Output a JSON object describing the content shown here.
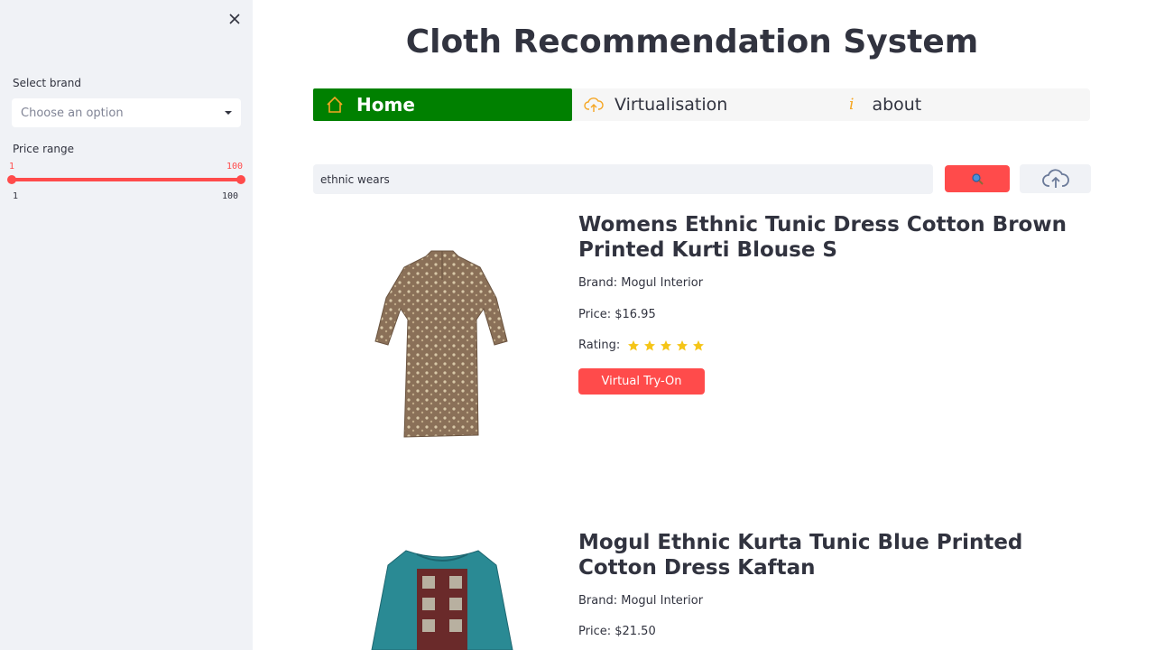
{
  "app_title": "Cloth Recommendation System",
  "sidebar": {
    "brand_label": "Select brand",
    "brand_placeholder": "Choose an option",
    "price_label": "Price range",
    "price_current_min": "1",
    "price_current_max": "100",
    "price_min": "1",
    "price_max": "100"
  },
  "nav": {
    "items": [
      {
        "label": "Home",
        "icon": "home-icon",
        "active": true
      },
      {
        "label": "Virtualisation",
        "icon": "cloud-upload-icon",
        "active": false
      },
      {
        "label": "about",
        "icon": "info-icon",
        "active": false
      }
    ],
    "active_color": "#008000"
  },
  "search": {
    "value": "ethnic wears",
    "search_icon": "magnifier-icon",
    "upload_icon": "cloud-upload-icon"
  },
  "products": [
    {
      "title": "Womens Ethnic Tunic Dress Cotton Brown Printed Kurti Blouse S",
      "brand": "Brand: Mogul Interior",
      "price": "Price: $16.95",
      "rating_label": "Rating:",
      "rating": 5,
      "button": "Virtual Try-On"
    },
    {
      "title": "Mogul Ethnic Kurta Tunic Blue Printed Cotton Dress Kaftan",
      "brand": "Brand: Mogul Interior",
      "price": "Price: $21.50"
    }
  ],
  "colors": {
    "accent": "#ff4b4b",
    "sidebar_bg": "#f0f2f6",
    "star": "#f5c518"
  }
}
